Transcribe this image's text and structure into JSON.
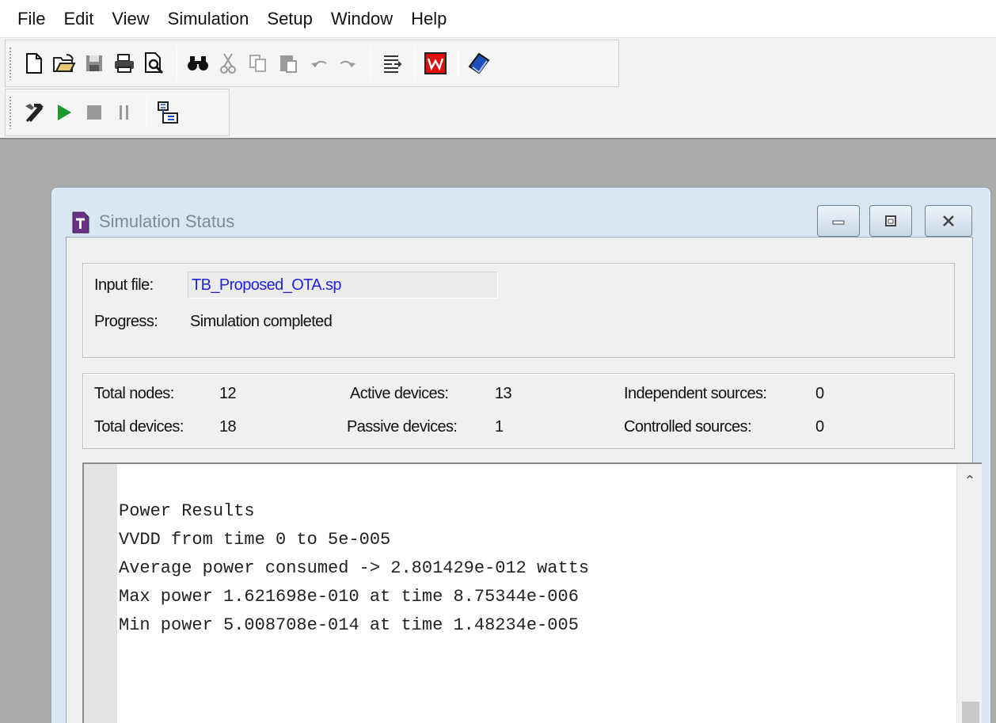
{
  "menu": [
    "File",
    "Edit",
    "View",
    "Simulation",
    "Setup",
    "Window",
    "Help"
  ],
  "toolbar1": {
    "icons": [
      "new-file-icon",
      "open-folder-icon",
      "save-icon",
      "print-icon",
      "print-preview-icon",
      "find-icon",
      "cut-icon",
      "copy-icon",
      "paste-icon",
      "undo-icon",
      "redo-icon",
      "list-icon",
      "w-logo-icon",
      "help-book-icon"
    ]
  },
  "toolbar2": {
    "icons": [
      "hammer-icon",
      "run-icon",
      "stop-icon",
      "pause-icon",
      "netlist-icon"
    ]
  },
  "window": {
    "title": "Simulation Status"
  },
  "status": {
    "input_file_label": "Input file:",
    "input_file_value": "TB_Proposed_OTA.sp",
    "progress_label": "Progress:",
    "progress_value": "Simulation completed"
  },
  "stats": {
    "total_nodes_label": "Total nodes:",
    "total_nodes_value": "12",
    "total_devices_label": "Total devices:",
    "total_devices_value": "18",
    "active_devices_label": "Active devices:",
    "active_devices_value": "13",
    "passive_devices_label": "Passive devices:",
    "passive_devices_value": "1",
    "independent_sources_label": "Independent sources:",
    "independent_sources_value": "0",
    "controlled_sources_label": "Controlled sources:",
    "controlled_sources_value": "0"
  },
  "output": {
    "lines": [
      "Power Results",
      "",
      "VVDD from time 0 to 5e-005",
      "Average power consumed -> 2.801429e-012 watts",
      "Max power 1.621698e-010 at time 8.75344e-006",
      "Min power 5.008708e-014 at time 1.48234e-005"
    ]
  },
  "colors": {
    "run_green": "#1a9a2a",
    "file_link_blue": "#2222dd",
    "w_logo_red": "#e01010"
  }
}
